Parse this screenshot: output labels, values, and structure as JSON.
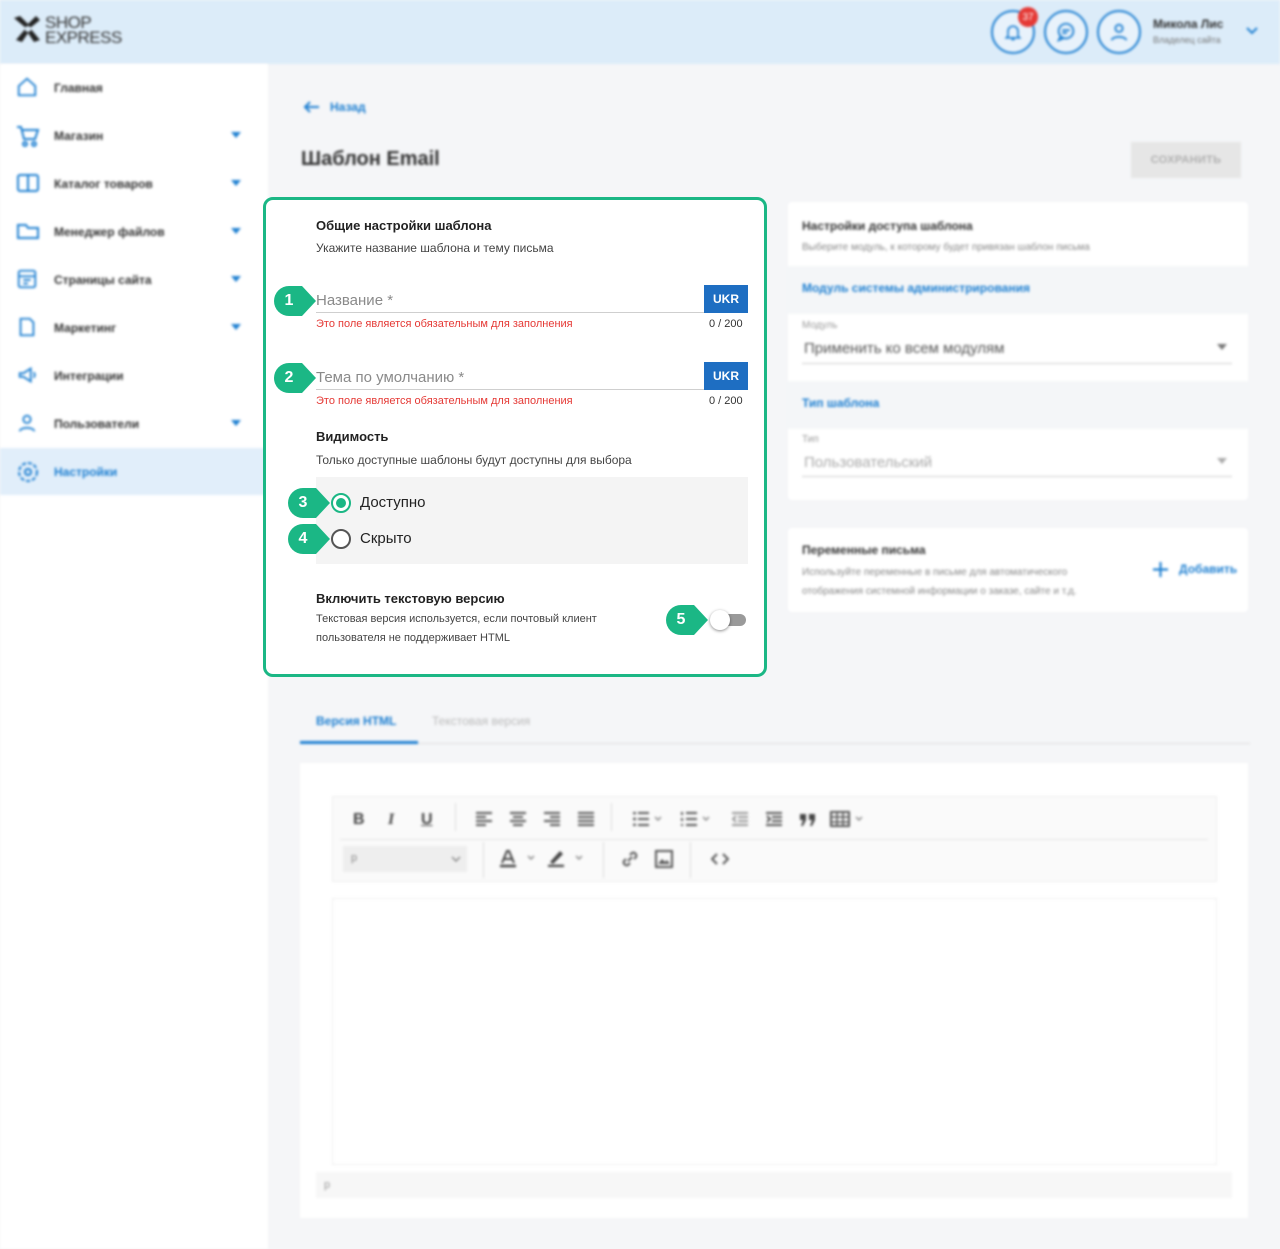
{
  "header": {
    "logo_line1": "SHOP",
    "logo_line2": "EXPRESS",
    "notifications_count": "37",
    "user_name": "Микола Лис",
    "user_role": "Владелец сайта"
  },
  "sidebar": {
    "items": [
      {
        "label": "Главная",
        "icon": "home-icon",
        "has_submenu": false,
        "active": false
      },
      {
        "label": "Магазин",
        "icon": "cart-icon",
        "has_submenu": true,
        "active": false
      },
      {
        "label": "Каталог товаров",
        "icon": "book-icon",
        "has_submenu": true,
        "active": false
      },
      {
        "label": "Менеджер файлов",
        "icon": "folder-icon",
        "has_submenu": true,
        "active": false
      },
      {
        "label": "Страницы сайта",
        "icon": "pages-icon",
        "has_submenu": true,
        "active": false
      },
      {
        "label": "Маркетинг",
        "icon": "marketing-icon",
        "has_submenu": true,
        "active": false
      },
      {
        "label": "Интеграции",
        "icon": "megaphone-icon",
        "has_submenu": false,
        "active": false
      },
      {
        "label": "Пользователи",
        "icon": "users-icon",
        "has_submenu": true,
        "active": false
      },
      {
        "label": "Настройки",
        "icon": "gear-icon",
        "has_submenu": false,
        "active": true
      }
    ]
  },
  "main": {
    "back_label": "Назад",
    "title": "Шаблон Email",
    "save_label": "СОХРАНИТЬ"
  },
  "general": {
    "title": "Общие настройки шаблона",
    "subtitle": "Укажите название шаблона и тему письма",
    "name_field": {
      "placeholder": "Название *",
      "lang": "UKR",
      "error": "Это поле является обязательным для заполнения",
      "counter": "0 / 200"
    },
    "subject_field": {
      "placeholder": "Тема по умолчанию *",
      "lang": "UKR",
      "error": "Это поле является обязательным для заполнения",
      "counter": "0 / 200"
    },
    "visibility_title": "Видимость",
    "visibility_sub": "Только доступные шаблоны будут доступны для выбора",
    "option_available": "Доступно",
    "option_hidden": "Скрыто",
    "selected_option": "Доступно",
    "text_version_title": "Включить текстовую версию",
    "text_version_sub_line1": "Текстовая версия используется, если почтовый клиент",
    "text_version_sub_line2": "пользователя не поддерживает HTML",
    "text_version_enabled": false
  },
  "markers": [
    "1",
    "2",
    "3",
    "4",
    "5"
  ],
  "access": {
    "title": "Настройки доступа шаблона",
    "subtitle": "Выберите модуль, к которому будет привязан шаблон письма",
    "module_link": "Модуль системы администрирования",
    "module_label": "Модуль",
    "module_value": "Применить ко всем модулям",
    "type_link": "Тип шаблона",
    "type_label": "Тип",
    "type_value": "Пользовательский"
  },
  "variables": {
    "title": "Переменные письма",
    "subtitle_line1": "Используйте переменные в письме для автоматического",
    "subtitle_line2": "отображения системной информации о заказе, сайте и т.д.",
    "add_label": "Добавить"
  },
  "tabs": [
    {
      "label": "Версия HTML",
      "active": true
    },
    {
      "label": "Текстовая версия",
      "active": false
    }
  ],
  "editor": {
    "paragraph_format": "p",
    "status_path": "p"
  },
  "colors": {
    "accent": "#1d7fd1",
    "highlight": "#1bb785",
    "error": "#e53935",
    "lang_badge": "#1e6ec2"
  }
}
